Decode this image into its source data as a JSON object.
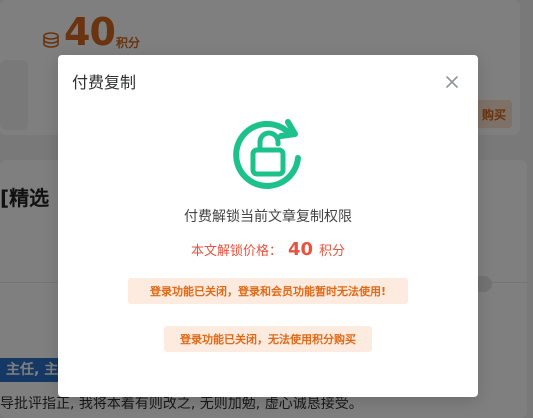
{
  "background": {
    "points_value": "40",
    "points_unit": "积分",
    "buy_chip_label": "购买",
    "article_title": "[精选",
    "title_prefix": "·",
    "highlight_text": "主任, 主",
    "body_text": "导批评指正, 我将本着有则改之, 无则加勉, 虚心诚恳接受。"
  },
  "modal": {
    "title": "付费复制",
    "description": "付费解锁当前文章复制权限",
    "price_label": "本文解锁价格：",
    "price_value": "40",
    "price_unit": "积分",
    "notice_login": "登录功能已关闭，登录和会员功能暂时无法使用!",
    "notice_points": "登录功能已关闭，无法使用积分购买"
  },
  "colors": {
    "accent_green": "#1cc28a",
    "price_red": "#e8533f",
    "notice_orange": "#e06a17",
    "notice_bg": "#fdebe0"
  },
  "icons": [
    "coin-stack-icon",
    "close-icon",
    "unlock-refresh-icon"
  ]
}
